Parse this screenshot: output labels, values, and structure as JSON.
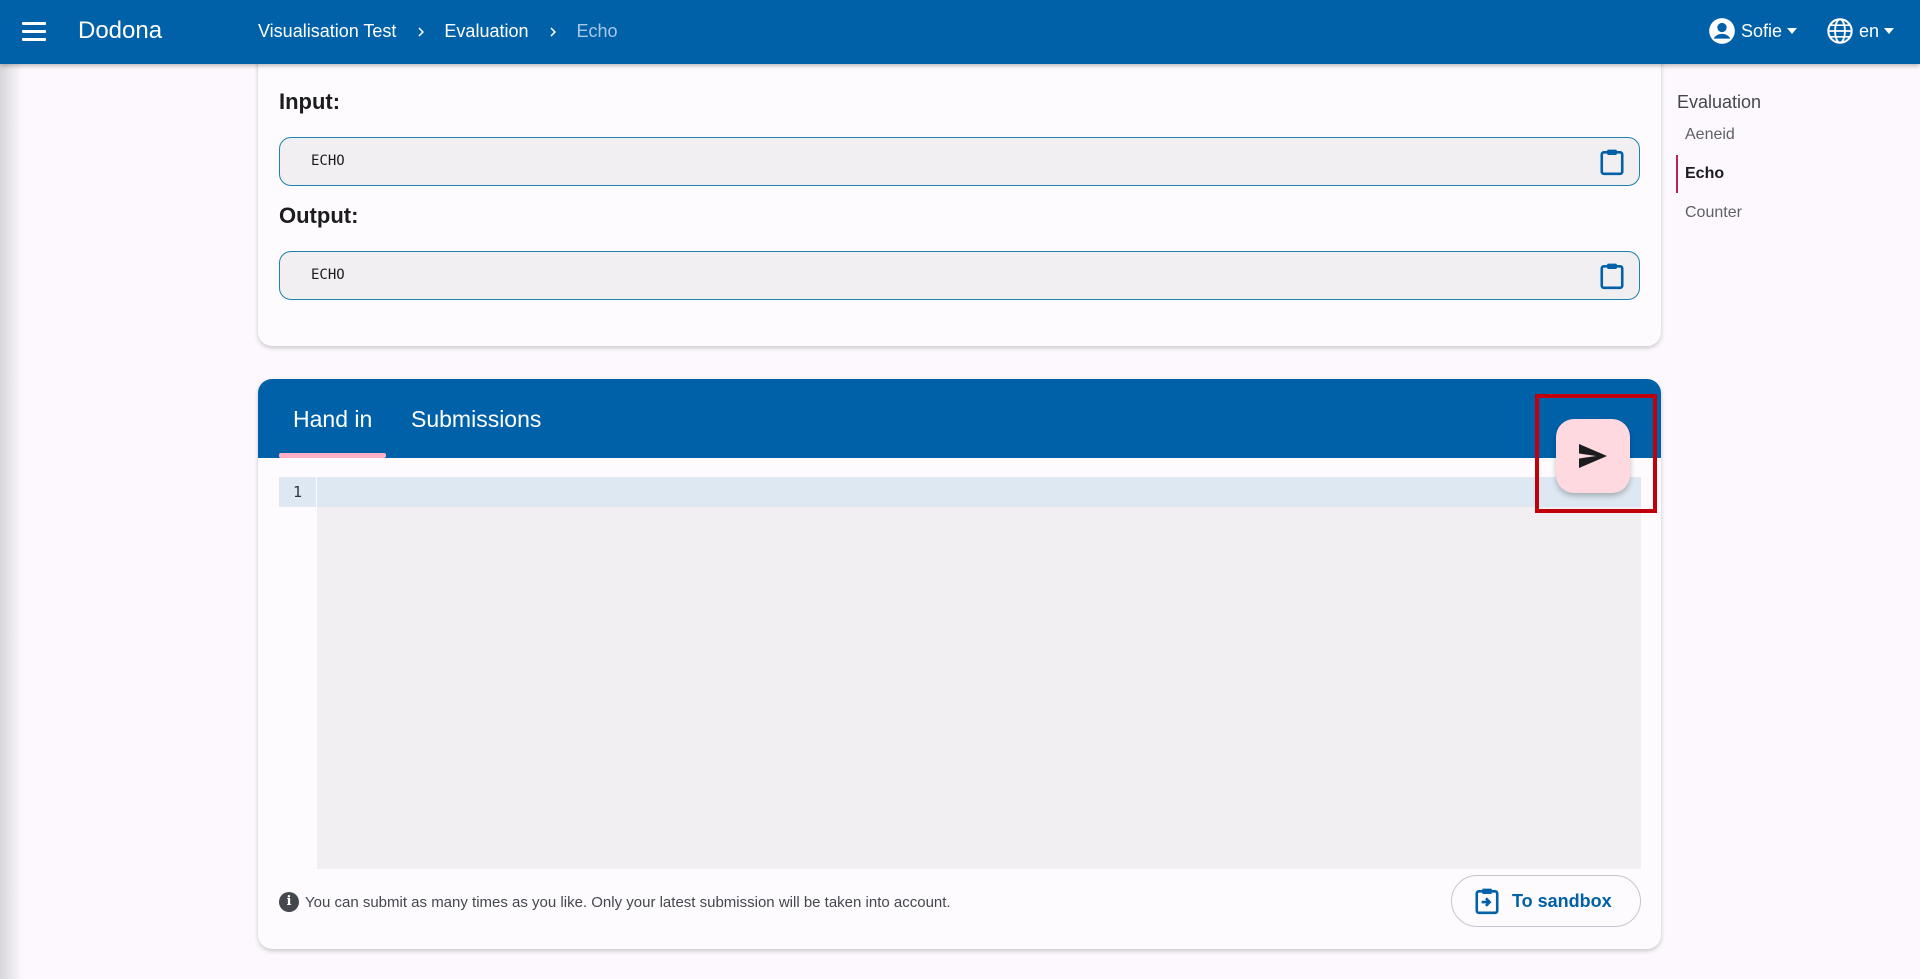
{
  "header": {
    "brand": "Dodona",
    "breadcrumbs": [
      "Visualisation Test",
      "Evaluation",
      "Echo"
    ],
    "user_name": "Sofie",
    "language": "en"
  },
  "exercise": {
    "input_label": "Input:",
    "input_value": "ECHO",
    "output_label": "Output:",
    "output_value": "ECHO"
  },
  "submission": {
    "tabs": [
      "Hand in",
      "Submissions"
    ],
    "active_tab": "Hand in",
    "line_numbers": [
      "1"
    ],
    "info_text": "You can submit as many times as you like. Only your latest submission will be taken into account.",
    "sandbox_label": "To sandbox"
  },
  "toc": {
    "title": "Evaluation",
    "items": [
      "Aeneid",
      "Echo",
      "Counter"
    ],
    "active_item": "Echo"
  },
  "colors": {
    "primary": "#0061a9",
    "fab": "#ffd9e0",
    "highlight": "#c0000a"
  },
  "icons": {
    "menu": "menu-icon",
    "user": "account-circle-icon",
    "globe": "globe-icon",
    "clipboard": "clipboard-icon",
    "send": "send-icon",
    "info": "info-icon",
    "sandbox": "clipboard-arrow-icon"
  }
}
